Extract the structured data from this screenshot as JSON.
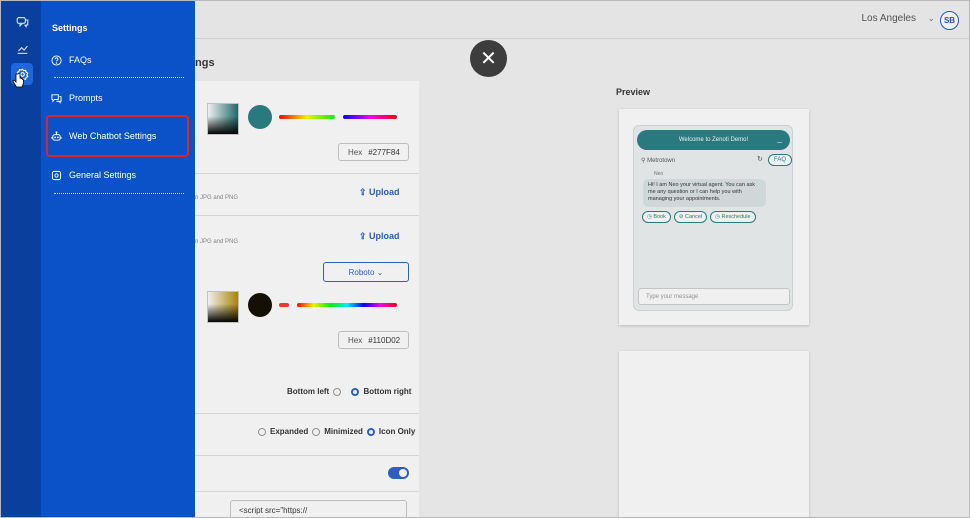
{
  "header": {
    "location": "Los Angeles",
    "avatar_initials": "SB"
  },
  "sidebar": {
    "title": "Settings",
    "items": [
      {
        "label": "FAQs",
        "icon": "question-icon"
      },
      {
        "label": "Prompts",
        "icon": "chat-bubbles-icon"
      },
      {
        "label": "Web Chatbot Settings",
        "icon": "robot-icon",
        "highlighted": true
      },
      {
        "label": "General Settings",
        "icon": "settings-icon"
      }
    ]
  },
  "rail": {
    "icons": [
      "chat-icon",
      "analytics-icon",
      "gear-icon"
    ]
  },
  "page": {
    "title_fragment": "ngs",
    "primary_hex_label": "Hex",
    "primary_hex": "#277F84",
    "secondary_hex_label": "Hex",
    "secondary_hex": "#110D02",
    "upload_label_1": "Upload",
    "upload_hint_1": "n JPG and PNG",
    "upload_label_2": "Upload",
    "upload_hint_2": "n JPG and PNG",
    "font_select": "Roboto",
    "position_options": [
      "Bottom left",
      "Bottom right"
    ],
    "position_selected": "Bottom right",
    "mode_options": [
      "Expanded",
      "Minimized",
      "Icon Only"
    ],
    "mode_selected": "Icon Only",
    "script_value": "<script src=\"https://",
    "colors": {
      "accent": "#2a62cf",
      "primary": "#277F84",
      "secondary": "#110D02"
    }
  },
  "preview": {
    "label": "Preview",
    "header_text": "Welcome to Zenoti Demo!",
    "minimize_glyph": "_",
    "location": "Metrotown",
    "faq_label": "FAQ",
    "agent_name": "Neo",
    "message": "Hi! I am Neo your virtual agent. You can ask me any question or I can help you with managing your appointments.",
    "buttons": [
      "Book",
      "Cancel",
      "Reschedule"
    ],
    "input_placeholder": "Type your message"
  },
  "overlay": {
    "close_glyph": "✕"
  }
}
